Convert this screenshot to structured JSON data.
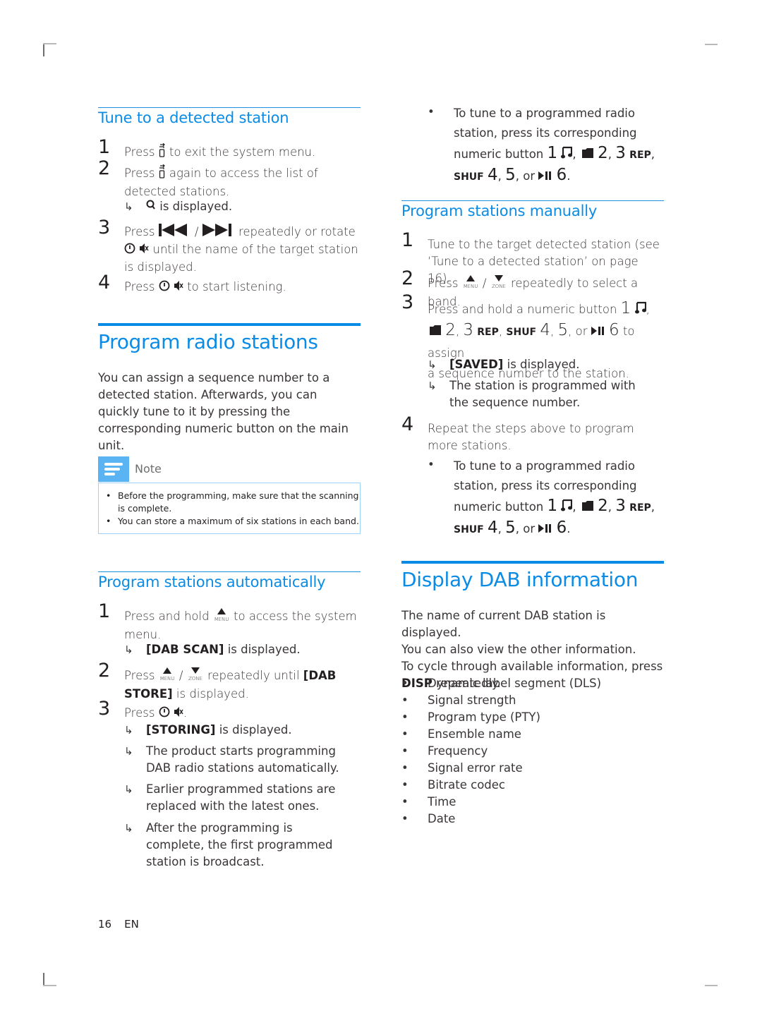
{
  "left": {
    "tune": {
      "heading": "Tune to a detected station",
      "steps": [
        {
          "num": "1",
          "pre": "Press ",
          "post": " to exit the system menu."
        },
        {
          "num": "2",
          "pre": "Press ",
          "post": " again to access the list of detected stations.",
          "result": " is displayed."
        },
        {
          "num": "3",
          "pre": "Press ",
          "mid": " / ",
          "post": " repeatedly or rotate",
          "line2": " until the name of the target station is displayed."
        },
        {
          "num": "4",
          "pre": "Press ",
          "post": " to start listening."
        }
      ]
    },
    "program": {
      "heading": "Program radio stations",
      "intro": "You can assign a sequence number to a detected station. Afterwards, you can quickly tune to it by pressing the corresponding numeric button on the main unit."
    },
    "note": {
      "label": "Note",
      "items": [
        "Before the programming, make sure that the scanning is complete.",
        "You can store a maximum of six stations in each band."
      ]
    },
    "auto": {
      "heading": "Program stations automatically",
      "steps": [
        {
          "num": "1",
          "pre": "Press and hold ",
          "post": " to access the system menu.",
          "results": [
            {
              "bold": "[DAB SCAN]",
              "text": " is displayed."
            }
          ]
        },
        {
          "num": "2",
          "pre": "Press ",
          "mid": " / ",
          "post": " repeatedly until ",
          "bold": "[DAB STORE]",
          "tail": " is displayed."
        },
        {
          "num": "3",
          "pre": "Press ",
          "post": ".",
          "results": [
            {
              "bold": "[STORING]",
              "text": " is displayed."
            },
            {
              "bold": "",
              "text": "The product starts programming DAB radio stations automatically."
            },
            {
              "bold": "",
              "text": "Earlier programmed stations are replaced with the latest ones."
            },
            {
              "bold": "",
              "text": "After the programming is complete, the first programmed station is broadcast."
            }
          ]
        }
      ]
    }
  },
  "right": {
    "tune_bullet": {
      "line1": "To tune to a programmed radio",
      "line2": "station, press its corresponding",
      "line3_pre": "numeric button "
    },
    "buttons": {
      "b1": "1",
      "b2": "2",
      "b3": "3",
      "rep": "REP",
      "shuf": "SHUF",
      "b4": "4",
      "b5": "5",
      "or": "or",
      "b6": "6",
      "comma": ",",
      "period": "."
    },
    "manual": {
      "heading": "Program stations manually",
      "steps": [
        {
          "num": "1",
          "text": "Tune to the target detected station (see ‘Tune to a detected station’ on page 16)."
        },
        {
          "num": "2",
          "pre": "Press ",
          "mid": " / ",
          "post": " repeatedly to select a band."
        },
        {
          "num": "3",
          "pre": "Press and hold a numeric button ",
          "post": " to assign",
          "line3": "a sequence number to the station.",
          "results": [
            {
              "bold": "[SAVED]",
              "text": " is displayed."
            },
            {
              "bold": "",
              "text": "The station is programmed with the sequence number."
            }
          ]
        },
        {
          "num": "4",
          "text": "Repeat the steps above to program more stations."
        }
      ]
    },
    "dab": {
      "heading": "Display DAB information",
      "p1": "The name of current DAB station is displayed.",
      "p2": "You can also view the other information.",
      "p3": "To cycle through available information, press",
      "p4_bold": "DISP",
      "p4": " repeatedly.",
      "items": [
        "Dynamic label segment (DLS)",
        "Signal strength",
        "Program type (PTY)",
        "Ensemble name",
        "Frequency",
        "Signal error rate",
        "Bitrate codec",
        "Time",
        "Date"
      ]
    }
  },
  "footer": {
    "page": "16",
    "lang": "EN"
  },
  "icons": {
    "menu_label": "MENU",
    "zone_label": "ZONE",
    "result_arrow": "↳",
    "bullet": "•"
  },
  "colors": {
    "accent": "#0a8ce6",
    "note_icon": "#5ab3f2",
    "note_border": "#9fd2f6"
  }
}
